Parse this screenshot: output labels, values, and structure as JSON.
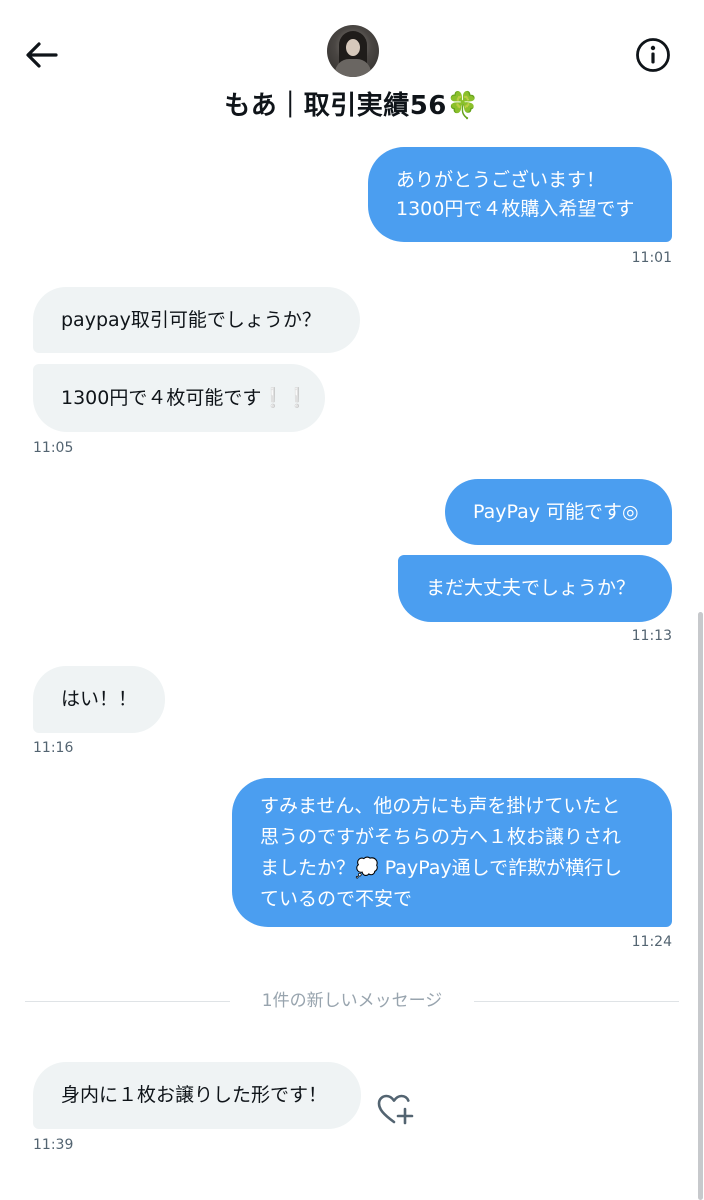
{
  "header": {
    "contact_name": "もあ｜取引実績56",
    "name_emoji": "🍀",
    "back_icon": "arrow-left-icon",
    "info_icon": "info-circle-icon"
  },
  "colors": {
    "sent_bubble": "#4b9ef0",
    "received_bubble": "#eff3f4",
    "timestamp": "#536471"
  },
  "messages": [
    {
      "direction": "sent",
      "lines": [
        "ありがとうございます！",
        "1300円で４枚購入希望です"
      ],
      "time": "11:01"
    },
    {
      "direction": "received",
      "lines": [
        "paypay取引可能でしょうか？"
      ],
      "time": ""
    },
    {
      "direction": "received",
      "lines": [
        "1300円で４枚可能です❕❕"
      ],
      "time": "11:05"
    },
    {
      "direction": "sent",
      "lines": [
        "PayPay 可能です◎"
      ],
      "time": ""
    },
    {
      "direction": "sent",
      "lines": [
        "まだ大丈夫でしょうか？"
      ],
      "time": "11:13"
    },
    {
      "direction": "received",
      "lines": [
        "はい！！"
      ],
      "time": "11:16"
    },
    {
      "direction": "sent",
      "lines": [
        "すみません、他の方にも声を掛けていたと",
        "思うのですがそちらの方へ１枚お譲りされ",
        "ましたか？💭 PayPay通しで詐欺が横行し",
        "ているので不安で"
      ],
      "time": "11:24"
    },
    {
      "direction": "received",
      "lines": [
        "身内に１枚お譲りした形です！"
      ],
      "time": "11:39"
    }
  ],
  "divider": {
    "label": "1件の新しいメッセージ"
  },
  "reaction": {
    "icon": "heart-plus-icon"
  }
}
